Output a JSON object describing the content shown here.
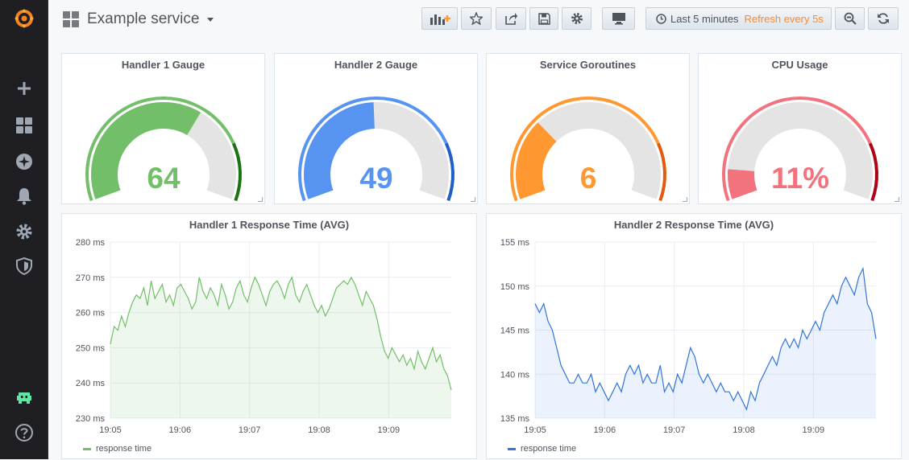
{
  "app": {
    "dashboard_title": "Example service",
    "time_range_label": "Last 5 minutes",
    "refresh_label": "Refresh every 5s"
  },
  "sidenav": {
    "items": [
      {
        "name": "grafana-logo-icon"
      },
      {
        "name": "plus-icon"
      },
      {
        "name": "dashboards-icon"
      },
      {
        "name": "explore-compass-icon"
      },
      {
        "name": "alerting-bell-icon"
      },
      {
        "name": "configuration-gear-icon"
      },
      {
        "name": "server-admin-shield-icon"
      },
      {
        "name": "user-avatar-icon"
      },
      {
        "name": "help-icon"
      }
    ]
  },
  "colors": {
    "green": "#73bf69",
    "blue": "#5794f2",
    "orange": "#ff9830",
    "red": "#f2727e",
    "refresh_text": "#fb8a2e"
  },
  "gauges": [
    {
      "title": "Handler 1 Gauge",
      "value_text": "64",
      "value": 64,
      "min": 0,
      "max": 100,
      "color": "#73bf69",
      "thresholds": [
        {
          "to": 80,
          "color": "#73bf69"
        },
        {
          "to": 100,
          "color": "#1a7311"
        }
      ]
    },
    {
      "title": "Handler 2 Gauge",
      "value_text": "49",
      "value": 49,
      "min": 0,
      "max": 100,
      "color": "#5794f2",
      "thresholds": [
        {
          "to": 80,
          "color": "#5794f2"
        },
        {
          "to": 100,
          "color": "#1f60c4"
        }
      ]
    },
    {
      "title": "Service Goroutines",
      "value_text": "6",
      "value": 6,
      "min": 0,
      "max": 20,
      "color": "#ff9830",
      "thresholds": [
        {
          "to": 16,
          "color": "#ff9830"
        },
        {
          "to": 20,
          "color": "#e05b0f"
        }
      ]
    },
    {
      "title": "CPU Usage",
      "value_text": "11%",
      "value": 11,
      "min": 0,
      "max": 100,
      "color": "#f2727e",
      "thresholds": [
        {
          "to": 80,
          "color": "#f2727e"
        },
        {
          "to": 100,
          "color": "#ad0317"
        }
      ]
    }
  ],
  "graphs": [
    {
      "title": "Handler 1 Response Time (AVG)",
      "legend": "response time",
      "color": "#73bf69",
      "fill": "rgba(115,191,105,0.12)",
      "y_ticks": [
        "280 ms",
        "270 ms",
        "260 ms",
        "250 ms",
        "240 ms",
        "230 ms"
      ],
      "y_min": 230,
      "y_max": 280,
      "x_ticks": [
        "19:05",
        "19:06",
        "19:07",
        "19:08",
        "19:09"
      ],
      "x_range": [
        0,
        4.9
      ],
      "values": [
        251,
        256,
        255,
        259,
        256,
        260,
        263,
        265,
        264,
        267,
        262,
        269,
        264,
        266,
        268,
        263,
        265,
        262,
        267,
        268,
        266,
        264,
        261,
        263,
        270,
        266,
        264,
        267,
        265,
        262,
        268,
        265,
        261,
        263,
        267,
        269,
        265,
        263,
        267,
        270,
        268,
        265,
        262,
        266,
        268,
        269,
        267,
        264,
        268,
        270,
        265,
        263,
        266,
        268,
        265,
        262,
        260,
        262,
        259,
        261,
        264,
        267,
        268,
        269,
        268,
        270,
        268,
        265,
        262,
        266,
        264,
        262,
        258,
        253,
        249,
        247,
        250,
        248,
        246,
        248,
        245,
        247,
        244,
        249,
        246,
        244,
        247,
        250,
        246,
        248,
        244,
        242,
        238
      ]
    },
    {
      "title": "Handler 2 Response Time (AVG)",
      "legend": "response time",
      "color": "#3274d9",
      "fill": "rgba(87,148,242,0.12)",
      "y_ticks": [
        "155 ms",
        "150 ms",
        "145 ms",
        "140 ms",
        "135 ms"
      ],
      "y_min": 135,
      "y_max": 155,
      "x_ticks": [
        "19:05",
        "19:06",
        "19:07",
        "19:08",
        "19:09"
      ],
      "x_range": [
        0,
        4.9
      ],
      "values": [
        148,
        147,
        148,
        146,
        145,
        143,
        141,
        140,
        139,
        139,
        140,
        139,
        139,
        140,
        138,
        139,
        138,
        137,
        138,
        139,
        138,
        140,
        141,
        140,
        141,
        139,
        140,
        139,
        139,
        141,
        138,
        139,
        138,
        140,
        139,
        141,
        143,
        142,
        140,
        139,
        140,
        139,
        138,
        139,
        138,
        138,
        137,
        138,
        137,
        136,
        138,
        137,
        139,
        140,
        141,
        142,
        141,
        143,
        144,
        143,
        144,
        143,
        145,
        144,
        145,
        146,
        145,
        147,
        148,
        149,
        148,
        150,
        151,
        150,
        149,
        151,
        152,
        148,
        147,
        144
      ]
    }
  ]
}
